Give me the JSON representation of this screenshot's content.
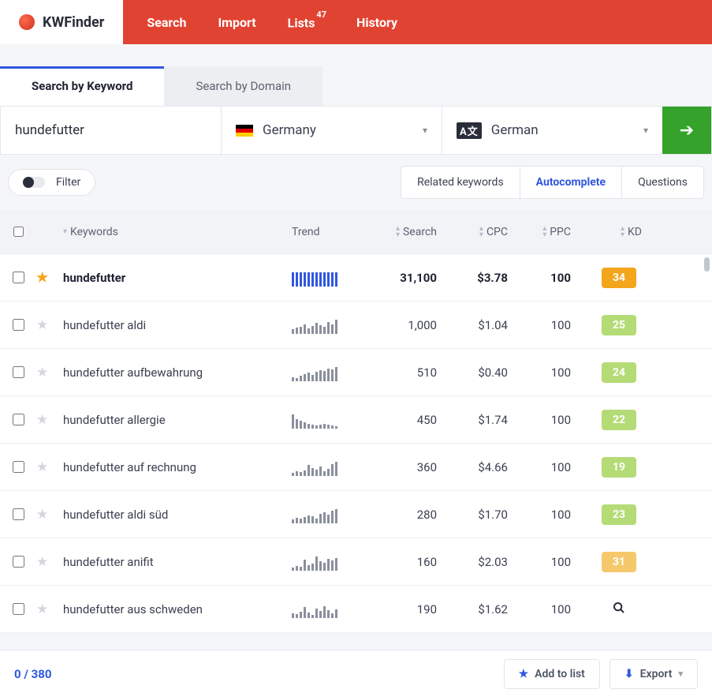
{
  "brand": "KWFinder",
  "nav": {
    "search": "Search",
    "import": "Import",
    "lists": "Lists",
    "lists_badge": "47",
    "history": "History"
  },
  "tabs": {
    "keyword": "Search by Keyword",
    "domain": "Search by Domain"
  },
  "search": {
    "value": "hundefutter",
    "location": "Germany",
    "language": "German"
  },
  "filter_label": "Filter",
  "result_tabs": {
    "related": "Related keywords",
    "auto": "Autocomplete",
    "questions": "Questions"
  },
  "columns": {
    "keywords": "Keywords",
    "trend": "Trend",
    "search": "Search",
    "cpc": "CPC",
    "ppc": "PPC",
    "kd": "KD"
  },
  "rows": [
    {
      "keyword": "hundefutter",
      "starred": true,
      "search": "31,100",
      "cpc": "$3.78",
      "ppc": "100",
      "kd": "34",
      "kd_color": "#f3a61c",
      "spark": [
        18,
        18,
        18,
        18,
        18,
        18,
        18,
        18,
        18,
        18,
        18,
        18
      ]
    },
    {
      "keyword": "hundefutter aldi",
      "starred": false,
      "search": "1,000",
      "cpc": "$1.04",
      "ppc": "100",
      "kd": "25",
      "kd_color": "#b4db76",
      "spark": [
        6,
        8,
        9,
        12,
        7,
        10,
        14,
        11,
        9,
        15,
        12,
        18
      ]
    },
    {
      "keyword": "hundefutter aufbewahrung",
      "starred": false,
      "search": "510",
      "cpc": "$0.40",
      "ppc": "100",
      "kd": "24",
      "kd_color": "#b4db76",
      "spark": [
        5,
        4,
        7,
        9,
        11,
        8,
        12,
        14,
        13,
        16,
        15,
        18
      ]
    },
    {
      "keyword": "hundefutter allergie",
      "starred": false,
      "search": "450",
      "cpc": "$1.74",
      "ppc": "100",
      "kd": "22",
      "kd_color": "#b4db76",
      "spark": [
        18,
        12,
        10,
        8,
        6,
        5,
        4,
        5,
        6,
        5,
        4,
        3
      ]
    },
    {
      "keyword": "hundefutter auf rechnung",
      "starred": false,
      "search": "360",
      "cpc": "$4.66",
      "ppc": "100",
      "kd": "19",
      "kd_color": "#b4db76",
      "spark": [
        4,
        6,
        5,
        7,
        14,
        10,
        8,
        12,
        6,
        9,
        15,
        18
      ]
    },
    {
      "keyword": "hundefutter aldi süd",
      "starred": false,
      "search": "280",
      "cpc": "$1.70",
      "ppc": "100",
      "kd": "23",
      "kd_color": "#b4db76",
      "spark": [
        5,
        7,
        6,
        8,
        10,
        9,
        6,
        12,
        14,
        11,
        16,
        18
      ]
    },
    {
      "keyword": "hundefutter anifit",
      "starred": false,
      "search": "160",
      "cpc": "$2.03",
      "ppc": "100",
      "kd": "31",
      "kd_color": "#f5c96b",
      "spark": [
        4,
        6,
        5,
        14,
        7,
        9,
        18,
        12,
        10,
        15,
        13,
        16
      ]
    },
    {
      "keyword": "hundefutter aus schweden",
      "starred": false,
      "search": "190",
      "cpc": "$1.62",
      "ppc": "100",
      "kd": null,
      "kd_color": null,
      "spark": [
        6,
        5,
        8,
        14,
        7,
        4,
        12,
        9,
        15,
        10,
        6,
        11
      ]
    }
  ],
  "footer": {
    "count_shown": "0",
    "count_sep": " / ",
    "count_total": "380",
    "add": "Add to list",
    "export": "Export"
  }
}
